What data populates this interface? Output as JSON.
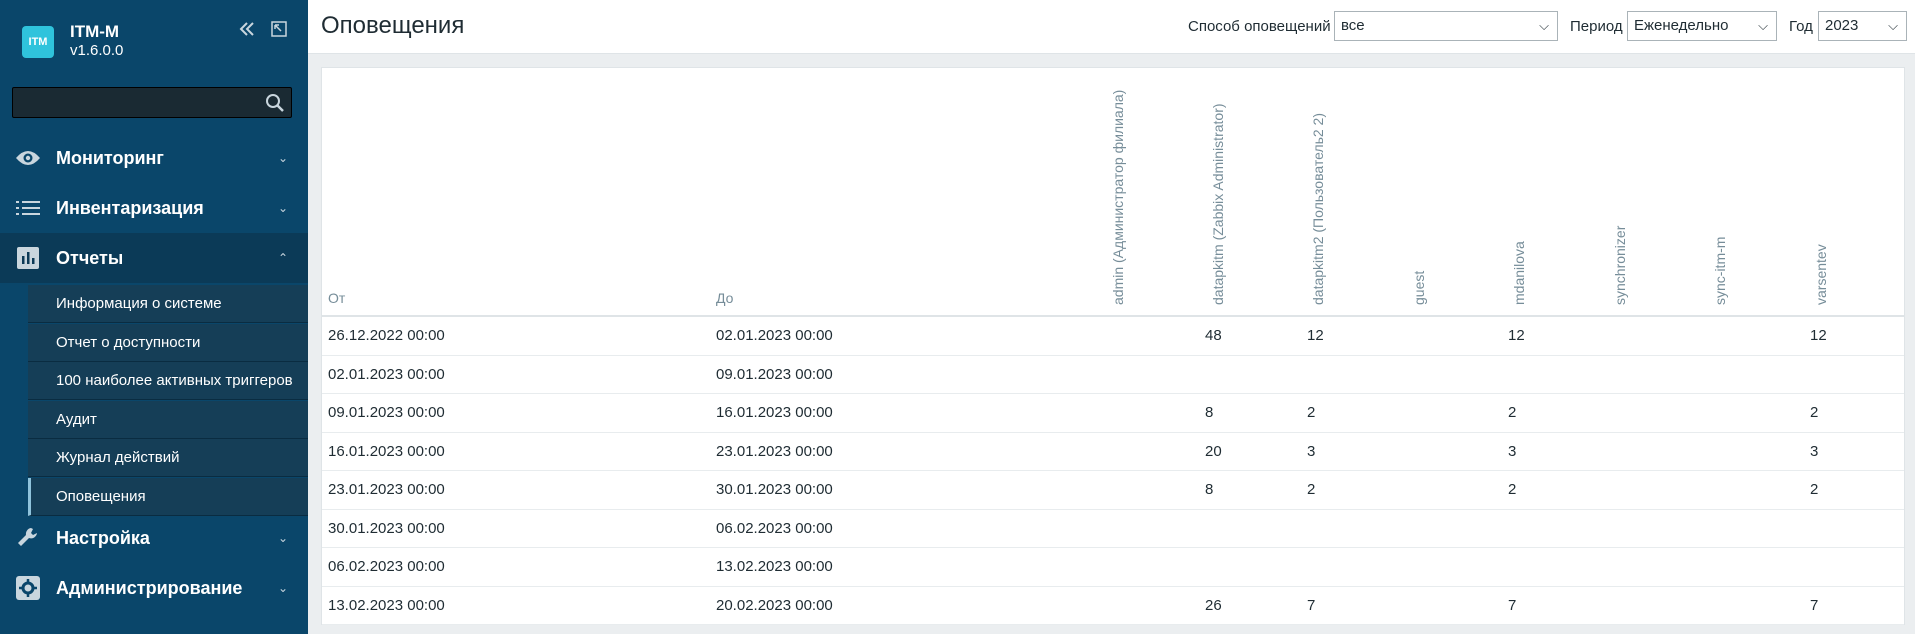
{
  "app": {
    "logo_text": "ITM",
    "name": "ITM-M",
    "version": "v1.6.0.0"
  },
  "search": {
    "value": "",
    "placeholder": ""
  },
  "sidebar": {
    "menu": [
      {
        "label": "Мониторинг",
        "icon": "eye-icon"
      },
      {
        "label": "Инвентаризация",
        "icon": "list-icon"
      },
      {
        "label": "Отчеты",
        "icon": "bar-chart-icon"
      },
      {
        "label": "Настройка",
        "icon": "wrench-icon"
      },
      {
        "label": "Администрирование",
        "icon": "admin-gear-icon"
      }
    ],
    "reports_sub": [
      "Информация о системе",
      "Отчет о доступности",
      "100 наиболее активных триггеров",
      "Аудит",
      "Журнал действий",
      "Оповещения"
    ]
  },
  "header": {
    "title": "Оповещения",
    "filters": {
      "method_label": "Способ оповещений",
      "method_value": "все",
      "period_label": "Период",
      "period_value": "Еженедельно",
      "year_label": "Год",
      "year_value": "2023"
    }
  },
  "table": {
    "col_from": "От",
    "col_to": "До",
    "users": [
      "admin (Администратор филиала)",
      "datapkitm (Zabbix Administrator)",
      "datapkitm2 (Пользователь2 2)",
      "guest",
      "mdanilova",
      "synchronizer",
      "sync-itm-m",
      "varsentev"
    ],
    "rows": [
      {
        "from": "26.12.2022 00:00",
        "to": "02.01.2023 00:00",
        "counts": [
          "",
          "48",
          "12",
          "",
          "12",
          "",
          "",
          "12"
        ]
      },
      {
        "from": "02.01.2023 00:00",
        "to": "09.01.2023 00:00",
        "counts": [
          "",
          "",
          "",
          "",
          "",
          "",
          "",
          ""
        ]
      },
      {
        "from": "09.01.2023 00:00",
        "to": "16.01.2023 00:00",
        "counts": [
          "",
          "8",
          "2",
          "",
          "2",
          "",
          "",
          "2"
        ]
      },
      {
        "from": "16.01.2023 00:00",
        "to": "23.01.2023 00:00",
        "counts": [
          "",
          "20",
          "3",
          "",
          "3",
          "",
          "",
          "3"
        ]
      },
      {
        "from": "23.01.2023 00:00",
        "to": "30.01.2023 00:00",
        "counts": [
          "",
          "8",
          "2",
          "",
          "2",
          "",
          "",
          "2"
        ]
      },
      {
        "from": "30.01.2023 00:00",
        "to": "06.02.2023 00:00",
        "counts": [
          "",
          "",
          "",
          "",
          "",
          "",
          "",
          ""
        ]
      },
      {
        "from": "06.02.2023 00:00",
        "to": "13.02.2023 00:00",
        "counts": [
          "",
          "",
          "",
          "",
          "",
          "",
          "",
          ""
        ]
      },
      {
        "from": "13.02.2023 00:00",
        "to": "20.02.2023 00:00",
        "counts": [
          "",
          "26",
          "7",
          "",
          "7",
          "",
          "",
          "7"
        ]
      }
    ]
  }
}
